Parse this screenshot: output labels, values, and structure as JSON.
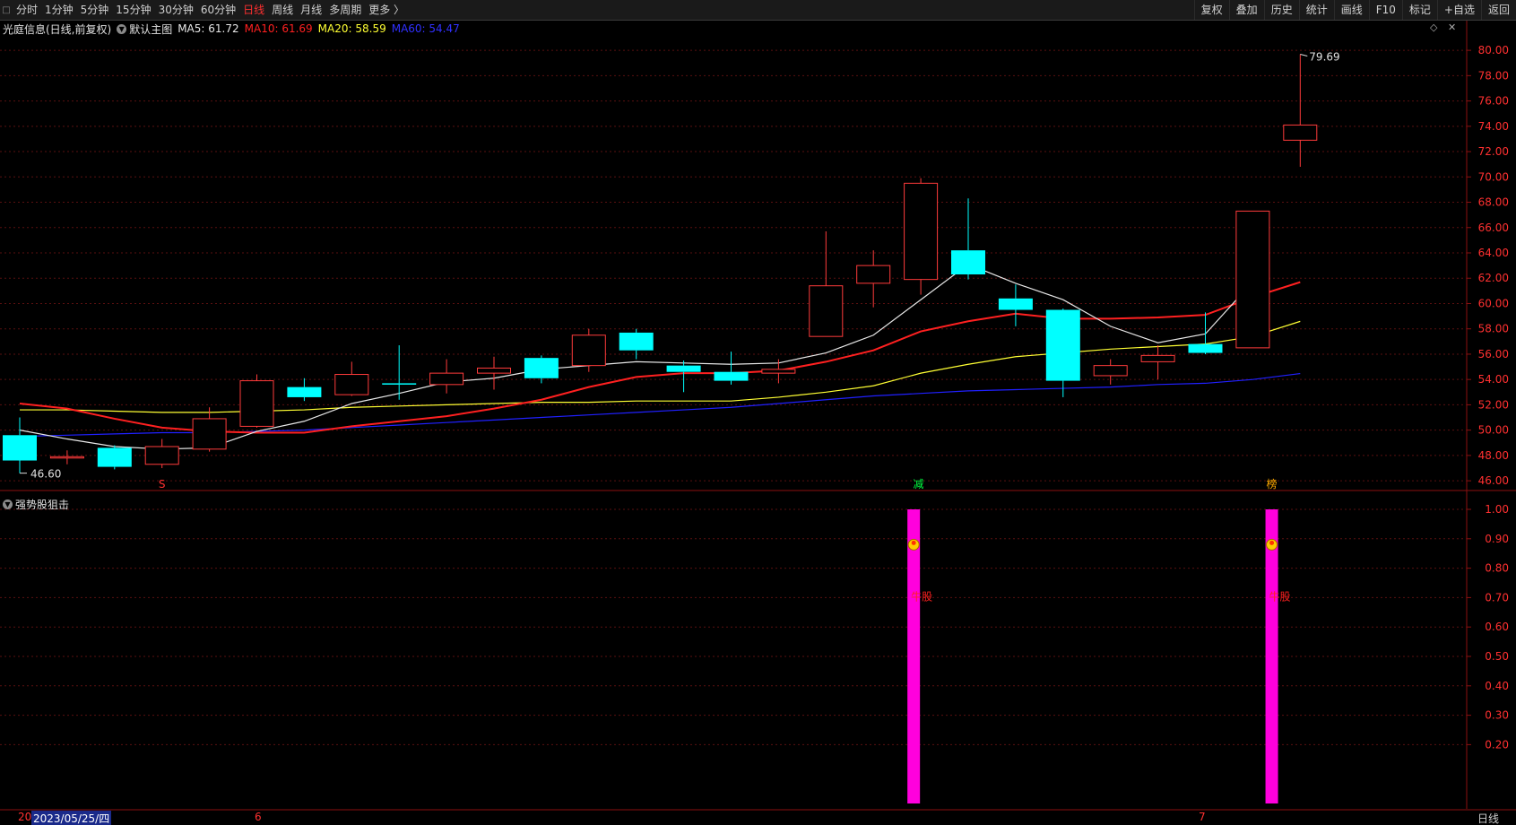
{
  "toolbar": {
    "periods": [
      "分时",
      "1分钟",
      "5分钟",
      "15分钟",
      "30分钟",
      "60分钟",
      "日线",
      "周线",
      "月线",
      "多周期",
      "更多 〉"
    ],
    "active_period": "日线",
    "actions": [
      "复权",
      "叠加",
      "历史",
      "统计",
      "画线",
      "F10",
      "标记",
      "+自选",
      "返回"
    ]
  },
  "legend": {
    "stock": "光庭信息(日线,前复权)",
    "main_chart": "默认主图",
    "ma5": "MA5: 61.72",
    "ma10": "MA10: 61.69",
    "ma20": "MA20: 58.59",
    "ma60": "MA60: 54.47"
  },
  "indicator": {
    "name": "强势股狙击",
    "signal_label": "牛股"
  },
  "markers": {
    "s": "S",
    "jian": "减",
    "bang": "榜"
  },
  "annotations": {
    "high": "79.69",
    "low": "46.60"
  },
  "date_bar": {
    "first": "20",
    "cursor_date": "2023/05/25/四",
    "month6": "6",
    "month7": "7",
    "period": "日线"
  },
  "colors": {
    "up": "#ff3b3b",
    "down": "#00ffff",
    "ma5": "#e8e8e8",
    "ma10": "#ff2020",
    "ma20": "#ffff33",
    "ma60": "#2020ff",
    "signal_bar": "#ff00dd"
  },
  "chart_data": [
    {
      "type": "candlestick",
      "title": "光庭信息(日线,前复权)",
      "ylim": [
        45.3,
        81.0
      ],
      "y_ticks": [
        80.0,
        78.0,
        76.0,
        74.0,
        72.0,
        70.0,
        68.0,
        66.0,
        64.0,
        62.0,
        60.0,
        58.0,
        56.0,
        54.0,
        52.0,
        50.0,
        48.0,
        46.0
      ],
      "candles": [
        {
          "o": 49.6,
          "c": 47.6,
          "h": 51.0,
          "l": 46.6
        },
        {
          "o": 47.9,
          "c": 47.9,
          "h": 48.4,
          "l": 47.3
        },
        {
          "o": 48.6,
          "c": 47.1,
          "h": 48.8,
          "l": 46.9
        },
        {
          "o": 47.3,
          "c": 48.7,
          "h": 49.3,
          "l": 47.0
        },
        {
          "o": 48.5,
          "c": 50.9,
          "h": 51.8,
          "l": 48.3
        },
        {
          "o": 50.3,
          "c": 53.9,
          "h": 54.4,
          "l": 50.2
        },
        {
          "o": 53.4,
          "c": 52.6,
          "h": 54.1,
          "l": 52.3
        },
        {
          "o": 52.8,
          "c": 54.4,
          "h": 55.4,
          "l": 52.7
        },
        {
          "o": 53.7,
          "c": 53.6,
          "h": 56.7,
          "l": 52.4
        },
        {
          "o": 53.6,
          "c": 54.5,
          "h": 55.6,
          "l": 52.9
        },
        {
          "o": 54.5,
          "c": 54.9,
          "h": 55.8,
          "l": 53.2
        },
        {
          "o": 55.7,
          "c": 54.1,
          "h": 55.9,
          "l": 53.7
        },
        {
          "o": 55.1,
          "c": 57.5,
          "h": 58.0,
          "l": 54.6
        },
        {
          "o": 57.7,
          "c": 56.3,
          "h": 58.0,
          "l": 55.6
        },
        {
          "o": 55.1,
          "c": 54.6,
          "h": 55.5,
          "l": 53.0
        },
        {
          "o": 54.6,
          "c": 53.9,
          "h": 56.2,
          "l": 53.6
        },
        {
          "o": 54.5,
          "c": 54.8,
          "h": 55.6,
          "l": 53.7
        },
        {
          "o": 57.4,
          "c": 61.4,
          "h": 65.7,
          "l": 57.4
        },
        {
          "o": 61.6,
          "c": 63.0,
          "h": 64.2,
          "l": 59.7
        },
        {
          "o": 61.9,
          "c": 69.5,
          "h": 69.9,
          "l": 60.7
        },
        {
          "o": 64.2,
          "c": 62.3,
          "h": 68.3,
          "l": 61.9
        },
        {
          "o": 60.4,
          "c": 59.5,
          "h": 61.5,
          "l": 58.2
        },
        {
          "o": 59.5,
          "c": 53.9,
          "h": 59.6,
          "l": 52.6
        },
        {
          "o": 54.3,
          "c": 55.1,
          "h": 55.6,
          "l": 53.6
        },
        {
          "o": 55.4,
          "c": 55.9,
          "h": 56.7,
          "l": 54.0
        },
        {
          "o": 56.8,
          "c": 56.1,
          "h": 59.3,
          "l": 56.0
        },
        {
          "o": 56.5,
          "c": 67.3,
          "h": 67.3,
          "l": 56.5
        },
        {
          "o": 72.9,
          "c": 74.1,
          "h": 79.69,
          "l": 70.8
        }
      ],
      "ma5": [
        50.0,
        49.3,
        48.7,
        48.5,
        48.6,
        49.9,
        50.7,
        52.1,
        52.9,
        53.8,
        54.1,
        54.8,
        55.1,
        55.4,
        55.3,
        55.2,
        55.3,
        56.1,
        57.5,
        60.3,
        63.1,
        61.6,
        60.3,
        58.2,
        56.9,
        57.6,
        61.72
      ],
      "ma10": [
        52.1,
        51.7,
        50.9,
        50.2,
        49.9,
        49.8,
        49.8,
        50.3,
        50.7,
        51.1,
        51.7,
        52.4,
        53.4,
        54.2,
        54.5,
        54.5,
        54.7,
        55.4,
        56.3,
        57.8,
        58.6,
        59.2,
        58.8,
        58.8,
        58.9,
        59.1,
        60.5,
        61.69
      ],
      "ma20": [
        51.6,
        51.6,
        51.5,
        51.4,
        51.4,
        51.5,
        51.6,
        51.8,
        51.9,
        52.0,
        52.1,
        52.2,
        52.2,
        52.3,
        52.3,
        52.3,
        52.6,
        53.0,
        53.5,
        54.5,
        55.2,
        55.8,
        56.1,
        56.4,
        56.6,
        56.8,
        57.4,
        58.59
      ],
      "ma60": [
        49.5,
        49.6,
        49.7,
        49.8,
        49.8,
        49.9,
        50.0,
        50.2,
        50.4,
        50.6,
        50.8,
        51.0,
        51.2,
        51.4,
        51.6,
        51.8,
        52.1,
        52.4,
        52.7,
        52.9,
        53.1,
        53.2,
        53.3,
        53.4,
        53.6,
        53.7,
        54.0,
        54.47
      ]
    },
    {
      "type": "bar",
      "title": "强势股狙击",
      "ylim": [
        0,
        1.0
      ],
      "y_ticks": [
        1.0,
        0.9,
        0.8,
        0.7,
        0.6,
        0.5,
        0.4,
        0.3,
        0.2
      ],
      "signals": [
        {
          "index": 18,
          "value": 1.0
        },
        {
          "index": 26,
          "value": 1.0
        }
      ]
    }
  ]
}
